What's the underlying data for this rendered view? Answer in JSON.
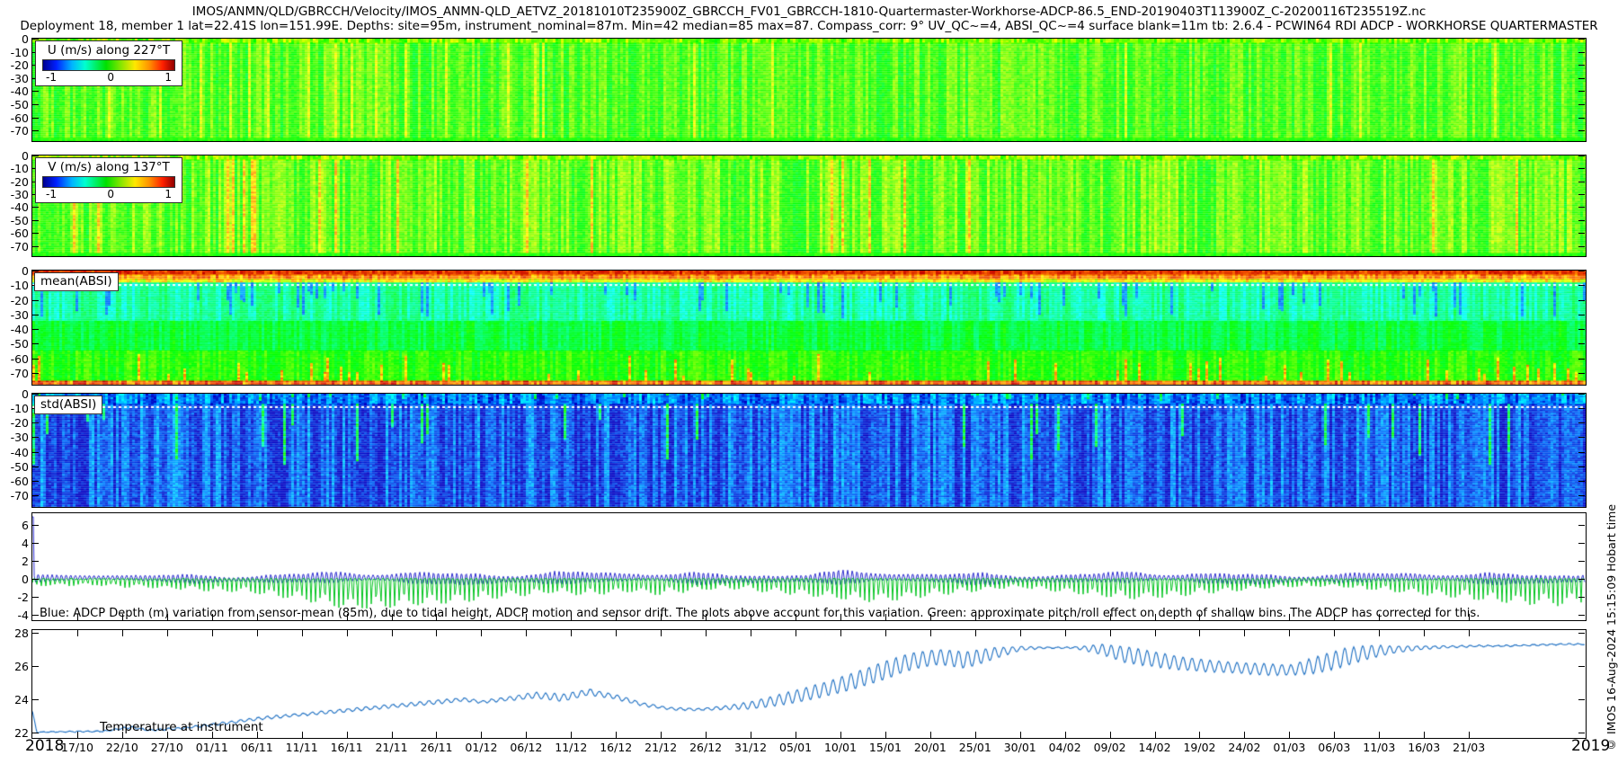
{
  "header": {
    "title_line1": "IMOS/ANMN/QLD/GBRCCH/Velocity/IMOS_ANMN-QLD_AETVZ_20181010T235900Z_GBRCCH_FV01_GBRCCH-1810-Quartermaster-Workhorse-ADCP-86.5_END-20190403T113900Z_C-20200116T235519Z.nc",
    "title_line2": "Deployment 18, member 1 lat=22.41S lon=151.99E. Depths: site=95m, instrument_nominal=87m. Min=42 median=85 max=87. Compass_corr: 9° UV_QC~=4, ABSI_QC~=4 surface blank=11m tb: 2.6.4 - PCWIN64 RDI ADCP - WORKHORSE QUARTERMASTER"
  },
  "watermark": "© IMOS 16-Aug-2024 15:15:09 Hobart time",
  "x_axis": {
    "year_left": "2018",
    "year_right": "2019",
    "first_tick_day": 5,
    "tick_step_days": 5,
    "total_days": 173,
    "tick_labels": [
      "17/10",
      "22/10",
      "27/10",
      "01/11",
      "06/11",
      "11/11",
      "16/11",
      "21/11",
      "26/11",
      "01/12",
      "06/12",
      "11/12",
      "16/12",
      "21/12",
      "26/12",
      "31/12",
      "05/01",
      "10/01",
      "15/01",
      "20/01",
      "25/01",
      "30/01",
      "04/02",
      "09/02",
      "14/02",
      "19/02",
      "24/02",
      "01/03",
      "06/03",
      "11/03",
      "16/03",
      "21/03"
    ]
  },
  "chart_data": [
    {
      "id": "u_velocity",
      "type": "heatmap",
      "legend": "U (m/s) along 227°T",
      "colorbar": {
        "min": -1,
        "max": 1,
        "tick_labels": [
          "-1",
          "0",
          "1"
        ],
        "colormap": "jet"
      },
      "y_tick_labels": [
        "0",
        "-10",
        "-20",
        "-30",
        "-40",
        "-50",
        "-60",
        "-70"
      ],
      "y_depth_range": [
        0,
        -78
      ],
      "summary": "Full-depth vertical stripes, mostly green to yellow-green (U ~ -0.1 to +0.4 m/s), occasional yellow bursts",
      "bands": [
        {
          "y0": 0,
          "y1": 0.04,
          "base": 0.62,
          "cj": 0.1,
          "rj": 0.04
        },
        {
          "y0": 0.04,
          "y1": 0.97,
          "base": 0.56,
          "cj": 0.085,
          "rj": 0.05,
          "hp": 0.05,
          "hv": 0.72
        },
        {
          "y0": 0.97,
          "y1": 1,
          "base": 0.52,
          "cj": 0.03,
          "rj": 0.02
        }
      ]
    },
    {
      "id": "v_velocity",
      "type": "heatmap",
      "legend": "V (m/s) along 137°T",
      "colorbar": {
        "min": -1,
        "max": 1,
        "tick_labels": [
          "-1",
          "0",
          "1"
        ],
        "colormap": "jet"
      },
      "y_tick_labels": [
        "0",
        "-10",
        "-20",
        "-30",
        "-40",
        "-50",
        "-60",
        "-70"
      ],
      "y_depth_range": [
        0,
        -78
      ],
      "summary": "Full-depth vertical stripes, green to yellow with sporadic orange/red columns",
      "bands": [
        {
          "y0": 0,
          "y1": 0.04,
          "base": 0.64,
          "cj": 0.1,
          "rj": 0.04
        },
        {
          "y0": 0.04,
          "y1": 0.97,
          "base": 0.585,
          "cj": 0.1,
          "rj": 0.05,
          "hp": 0.045,
          "hv": 0.8
        },
        {
          "y0": 0.97,
          "y1": 1,
          "base": 0.52,
          "cj": 0.03,
          "rj": 0.02
        }
      ]
    },
    {
      "id": "mean_absi",
      "type": "heatmap",
      "label": "mean(ABSI)",
      "y_tick_labels": [
        "0",
        "-10",
        "-20",
        "-30",
        "-40",
        "-50",
        "-60",
        "-70"
      ],
      "y_depth_range": [
        0,
        -78
      ],
      "dotline": 0.115,
      "summary": "High backscatter (orange/red) near surface, cyan-blue mid layer 10-35m, green-cyan below, green near bottom with yellow/red streaks and red bottom edge",
      "bands": [
        {
          "y0": 0,
          "y1": 0.035,
          "base": 0.94,
          "cj": 0.04,
          "rj": 0.03
        },
        {
          "y0": 0.035,
          "y1": 0.075,
          "base": 0.86,
          "cj": 0.07,
          "rj": 0.04
        },
        {
          "y0": 0.075,
          "y1": 0.105,
          "base": 0.74,
          "cj": 0.09,
          "rj": 0.05
        },
        {
          "y0": 0.105,
          "y1": 0.44,
          "base": 0.345,
          "cj": 0.075,
          "rj": 0.04,
          "cp": 0.12,
          "cv": 0.14
        },
        {
          "y0": 0.44,
          "y1": 0.7,
          "base": 0.45,
          "cj": 0.06,
          "rj": 0.035
        },
        {
          "y0": 0.7,
          "y1": 0.965,
          "base": 0.53,
          "cj": 0.06,
          "rj": 0.04,
          "hp": 0.1,
          "hv": 0.82,
          "hfb": true
        },
        {
          "y0": 0.965,
          "y1": 1,
          "base": 0.9,
          "cj": 0.08,
          "rj": 0.05
        }
      ]
    },
    {
      "id": "std_absi",
      "type": "heatmap",
      "label": "std(ABSI)",
      "y_tick_labels": [
        "0",
        "-10",
        "-20",
        "-30",
        "-40",
        "-50",
        "-60",
        "-70"
      ],
      "y_depth_range": [
        0,
        -78
      ],
      "dotline": 0.115,
      "summary": "Mostly dark blue (low std) with lighter blue columns and sporadic cyan/green streaks; white dotted line near -10m",
      "bands": [
        {
          "y0": 0,
          "y1": 0.09,
          "base": 0.13,
          "cj": 0.09,
          "rj": 0.06,
          "hp": 0.06,
          "hv": 0.4,
          "hft": true
        },
        {
          "y0": 0.09,
          "y1": 1,
          "base": 0.085,
          "cj": 0.08,
          "rj": 0.05,
          "hp": 0.05,
          "hv": 0.42,
          "hft": true
        }
      ]
    },
    {
      "id": "depth_variation",
      "type": "line",
      "ylim": [
        -4.6,
        7.3
      ],
      "y_tick_labels": [
        "6",
        "4",
        "2",
        "0",
        "-2",
        "-4"
      ],
      "annotation": "Blue: ADCP Depth (m) variation from sensor-mean (85m), due to tidal height, ADCP motion and sensor drift. The plots above account for this variation. Green: approximate pitch/roll effect on depth of shallow bins. The ADCP has corrected for this.",
      "series": [
        {
          "name": "adcp_depth_variation",
          "color": "#2525cc",
          "amplitude_envelope": [
            [
              0,
              0.5
            ],
            [
              5,
              0.35
            ],
            [
              10,
              0.55
            ],
            [
              14,
              0.4
            ],
            [
              18,
              0.65
            ],
            [
              22,
              0.45
            ],
            [
              26,
              0.8
            ],
            [
              30,
              0.55
            ],
            [
              34,
              0.85
            ],
            [
              38,
              0.6
            ],
            [
              42,
              0.95
            ],
            [
              46,
              0.65
            ],
            [
              50,
              1.0
            ],
            [
              54,
              0.7
            ],
            [
              58,
              0.95
            ],
            [
              62,
              0.65
            ],
            [
              66,
              0.9
            ],
            [
              70,
              0.6
            ],
            [
              74,
              0.85
            ],
            [
              78,
              0.55
            ],
            [
              82,
              0.9
            ],
            [
              86,
              0.6
            ],
            [
              90,
              0.95
            ],
            [
              94,
              0.65
            ],
            [
              98,
              0.9
            ],
            [
              102,
              0.6
            ],
            [
              106,
              0.85
            ],
            [
              110,
              0.55
            ],
            [
              114,
              0.8
            ],
            [
              118,
              0.5
            ],
            [
              122,
              0.85
            ],
            [
              126,
              0.6
            ],
            [
              130,
              0.9
            ],
            [
              134,
              0.6
            ],
            [
              138,
              0.8
            ],
            [
              142,
              0.55
            ],
            [
              146,
              0.75
            ],
            [
              150,
              0.5
            ],
            [
              154,
              0.8
            ],
            [
              158,
              0.55
            ],
            [
              162,
              0.85
            ],
            [
              166,
              0.6
            ],
            [
              170,
              0.9
            ],
            [
              173,
              0.8
            ]
          ]
        },
        {
          "name": "pitch_roll_effect",
          "color": "#00c41e",
          "spike_envelope": [
            [
              0,
              0.9
            ],
            [
              6,
              0.7
            ],
            [
              12,
              1.0
            ],
            [
              18,
              1.3
            ],
            [
              24,
              1.6
            ],
            [
              30,
              2.4
            ],
            [
              34,
              3.2
            ],
            [
              38,
              3.4
            ],
            [
              42,
              3.0
            ],
            [
              46,
              2.8
            ],
            [
              50,
              2.4
            ],
            [
              54,
              2.0
            ],
            [
              58,
              1.6
            ],
            [
              62,
              1.9
            ],
            [
              66,
              1.5
            ],
            [
              70,
              1.8
            ],
            [
              74,
              1.3
            ],
            [
              78,
              1.1
            ],
            [
              82,
              1.5
            ],
            [
              86,
              1.9
            ],
            [
              90,
              2.3
            ],
            [
              94,
              2.6
            ],
            [
              98,
              2.2
            ],
            [
              102,
              1.7
            ],
            [
              106,
              1.3
            ],
            [
              110,
              1.0
            ],
            [
              114,
              1.4
            ],
            [
              118,
              1.9
            ],
            [
              122,
              2.3
            ],
            [
              126,
              2.1
            ],
            [
              130,
              1.7
            ],
            [
              134,
              1.4
            ],
            [
              138,
              1.1
            ],
            [
              142,
              0.9
            ],
            [
              146,
              1.0
            ],
            [
              150,
              1.3
            ],
            [
              154,
              1.7
            ],
            [
              158,
              2.1
            ],
            [
              162,
              2.5
            ],
            [
              166,
              2.8
            ],
            [
              170,
              3.0
            ],
            [
              173,
              2.6
            ]
          ]
        }
      ]
    },
    {
      "id": "temperature",
      "type": "line",
      "label": "Temperature at instrument",
      "ylim": [
        21.7,
        28.15
      ],
      "y_tick_labels": [
        "28",
        "26",
        "24",
        "22"
      ],
      "series": [
        {
          "name": "temperature_c",
          "color": "#1b6ec2",
          "keypoints": [
            [
              0,
              23.3,
              0
            ],
            [
              0.5,
              22.05,
              0.02
            ],
            [
              8,
              22.1,
              0.04
            ],
            [
              11,
              22.35,
              0.06
            ],
            [
              13,
              22.15,
              0.04
            ],
            [
              17,
              22.3,
              0.05
            ],
            [
              21,
              22.55,
              0.07
            ],
            [
              25,
              22.85,
              0.08
            ],
            [
              29,
              23.05,
              0.08
            ],
            [
              33,
              23.25,
              0.09
            ],
            [
              37,
              23.45,
              0.1
            ],
            [
              41,
              23.65,
              0.1
            ],
            [
              45,
              23.85,
              0.12
            ],
            [
              48,
              24.0,
              0.1
            ],
            [
              50,
              23.85,
              0.08
            ],
            [
              53,
              24.05,
              0.12
            ],
            [
              56,
              24.25,
              0.18
            ],
            [
              59,
              24.1,
              0.22
            ],
            [
              62,
              24.45,
              0.18
            ],
            [
              65,
              24.15,
              0.14
            ],
            [
              68,
              23.7,
              0.1
            ],
            [
              71,
              23.45,
              0.07
            ],
            [
              74,
              23.4,
              0.06
            ],
            [
              77,
              23.5,
              0.1
            ],
            [
              80,
              23.65,
              0.22
            ],
            [
              83,
              23.95,
              0.32
            ],
            [
              86,
              24.3,
              0.4
            ],
            [
              89,
              24.7,
              0.45
            ],
            [
              92,
              25.2,
              0.5
            ],
            [
              95,
              25.75,
              0.55
            ],
            [
              98,
              26.3,
              0.5
            ],
            [
              101,
              26.55,
              0.45
            ],
            [
              104,
              26.35,
              0.5
            ],
            [
              107,
              26.75,
              0.35
            ],
            [
              110,
              27.05,
              0.12
            ],
            [
              113,
              27.1,
              0.04
            ],
            [
              116,
              27.1,
              0.04
            ],
            [
              119,
              27.0,
              0.3
            ],
            [
              122,
              26.65,
              0.5
            ],
            [
              125,
              26.4,
              0.45
            ],
            [
              128,
              26.15,
              0.4
            ],
            [
              131,
              26.0,
              0.35
            ],
            [
              134,
              25.9,
              0.32
            ],
            [
              137,
              25.8,
              0.35
            ],
            [
              140,
              25.75,
              0.3
            ],
            [
              143,
              26.05,
              0.5
            ],
            [
              146,
              26.5,
              0.55
            ],
            [
              149,
              26.85,
              0.4
            ],
            [
              152,
              27.0,
              0.2
            ],
            [
              155,
              27.1,
              0.1
            ],
            [
              158,
              27.15,
              0.06
            ],
            [
              161,
              27.2,
              0.05
            ],
            [
              164,
              27.2,
              0.04
            ],
            [
              167,
              27.25,
              0.04
            ],
            [
              170,
              27.3,
              0.04
            ],
            [
              173,
              27.3,
              0.04
            ]
          ]
        }
      ]
    }
  ]
}
